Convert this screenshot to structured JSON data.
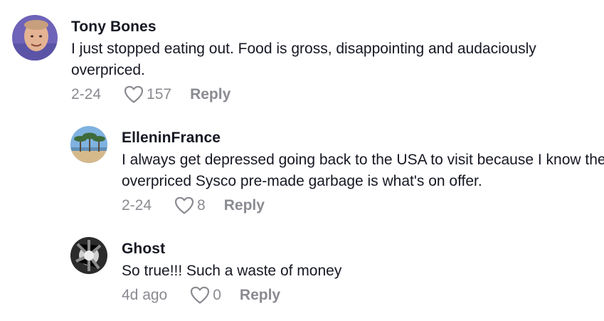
{
  "comments": [
    {
      "username": "Tony Bones",
      "text": "I just stopped eating out. Food is gross, disappointing and audaciously overpriced.",
      "date": "2-24",
      "likes": "157",
      "reply_label": "Reply"
    },
    {
      "username": "ElleninFrance",
      "text": "I always get depressed going back to the USA to visit because I know the overpriced Sysco pre-made garbage is what's on offer.",
      "date": "2-24",
      "likes": "8",
      "reply_label": "Reply"
    },
    {
      "username": "Ghost",
      "text": "So true!!! Such a waste of money",
      "date": "4d ago",
      "likes": "0",
      "reply_label": "Reply"
    }
  ],
  "icons": {
    "like": "heart-outline-icon"
  },
  "colors": {
    "text": "#161823",
    "meta": "#8a8b91"
  }
}
